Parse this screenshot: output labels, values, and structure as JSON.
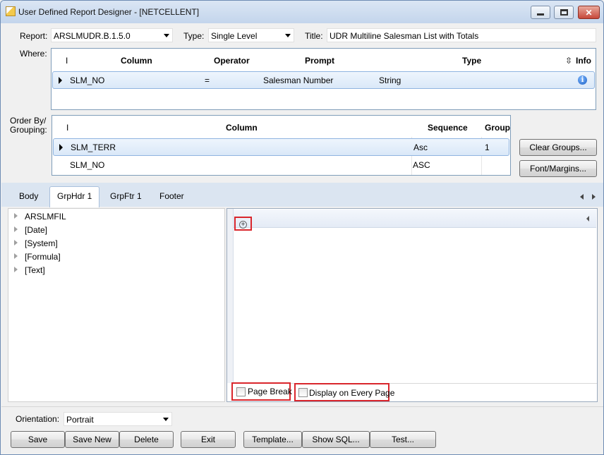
{
  "window": {
    "title": "User Defined Report Designer - [NETCELLENT]"
  },
  "header": {
    "report_label": "Report:",
    "report_value": "ARSLMUDR.B.1.5.0",
    "type_label": "Type:",
    "type_value": "Single Level",
    "title_label": "Title:",
    "title_value": "UDR Multiline Salesman List with Totals"
  },
  "where": {
    "label": "Where:",
    "columns": [
      "I",
      "Column",
      "Operator",
      "Prompt",
      "Type",
      "Info"
    ],
    "rows": [
      {
        "column": "SLM_NO",
        "operator": "=",
        "prompt": "Salesman Number",
        "type": "String",
        "info_icon": "info-icon"
      }
    ]
  },
  "orderby": {
    "label_line1": "Order By/",
    "label_line2": "Grouping:",
    "columns": [
      "I",
      "Column",
      "Sequence",
      "Group"
    ],
    "rows": [
      {
        "column": "SLM_TERR",
        "sequence": "Asc",
        "group": "1"
      },
      {
        "column": "SLM_NO",
        "sequence": "ASC",
        "group": ""
      }
    ]
  },
  "side_buttons": {
    "clear_groups": "Clear Groups...",
    "font_margins": "Font/Margins..."
  },
  "tabs": [
    {
      "label": "Body"
    },
    {
      "label": "GrpHdr 1"
    },
    {
      "label": "GrpFtr 1"
    },
    {
      "label": "Footer"
    }
  ],
  "tree": {
    "items": [
      "ARSLMFIL",
      "[Date]",
      "[System]",
      "[Formula]",
      "[Text]"
    ]
  },
  "options": {
    "page_break": "Page Break",
    "display_every_page": "Display on Every Page"
  },
  "orientation": {
    "label": "Orientation:",
    "value": "Portrait"
  },
  "buttons": {
    "save": "Save",
    "save_new": "Save New",
    "delete": "Delete",
    "exit": "Exit",
    "template": "Template...",
    "show_sql": "Show SQL...",
    "test": "Test..."
  },
  "colors": {
    "highlight": "#d9262c",
    "tab_band": "#dbe5f1",
    "selected_row": "#dae8f8"
  }
}
